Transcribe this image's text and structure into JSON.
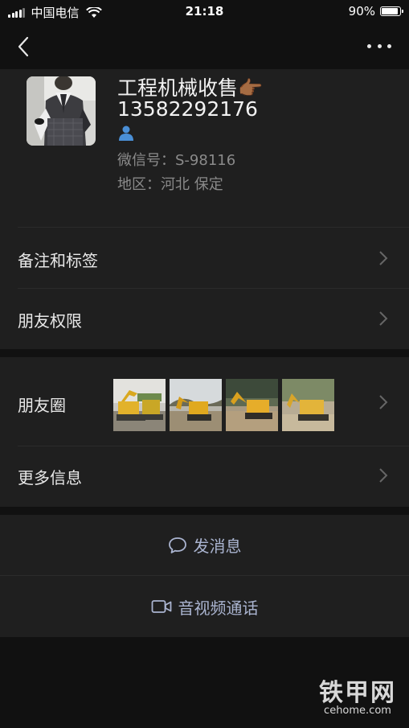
{
  "status_bar": {
    "carrier": "中国电信",
    "time": "21:18",
    "battery": "90%",
    "battery_level": 0.9
  },
  "nav": {
    "back_icon": "chevron-left-icon",
    "more_icon": "ellipsis-icon"
  },
  "profile": {
    "name": "工程机械收售👉🏾",
    "phone": "13582292176",
    "contact_icon": "person-icon",
    "wechat_label": "微信号：",
    "wechat_id": "S-98116",
    "region_label": "地区：",
    "region": "河北 保定"
  },
  "rows": {
    "remarks": "备注和标签",
    "permissions": "朋友权限",
    "moments": "朋友圈",
    "more_info": "更多信息"
  },
  "actions": {
    "message": "发消息",
    "message_icon": "chat-bubble-icon",
    "call": "音视频通话",
    "call_icon": "video-camera-icon"
  },
  "watermark": {
    "name": "铁甲网",
    "url": "cehome.com"
  },
  "colors": {
    "background": "#111111",
    "card": "#1f1f1f",
    "action_text": "#aab4d0",
    "secondary_text": "#8a8a8a"
  }
}
